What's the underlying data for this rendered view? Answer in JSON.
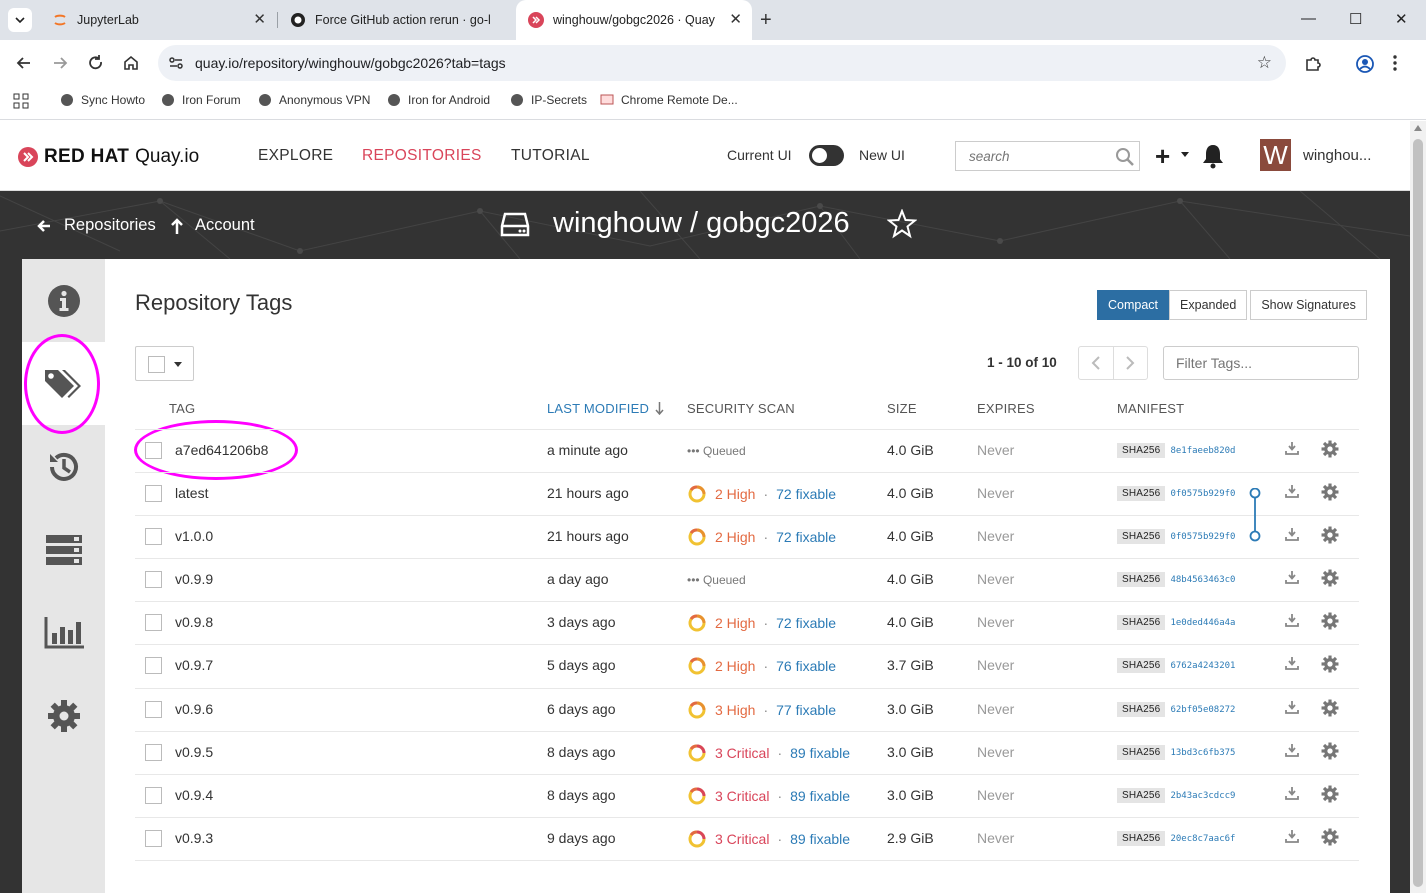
{
  "browser": {
    "tabs": [
      {
        "title": "JupyterLab"
      },
      {
        "title": "Force GitHub action rerun · go-l"
      },
      {
        "title": "winghouw/gobgc2026 · Quay"
      }
    ],
    "url": "quay.io/repository/winghouw/gobgc2026?tab=tags",
    "bookmarks": [
      "Sync Howto",
      "Iron Forum",
      "Anonymous VPN",
      "Iron for Android",
      "IP-Secrets",
      "Chrome Remote De..."
    ]
  },
  "header": {
    "logo_redhat": "RED HAT",
    "logo_quay": "Quay.io",
    "nav": [
      "EXPLORE",
      "REPOSITORIES",
      "TUTORIAL"
    ],
    "active_nav": "REPOSITORIES",
    "current_ui": "Current UI",
    "new_ui": "New UI",
    "search_placeholder": "search",
    "avatar_letter": "W",
    "username": "winghou..."
  },
  "repo": {
    "breadcrumb_repositories": "Repositories",
    "breadcrumb_account": "Account",
    "title": "winghouw / gobgc2026"
  },
  "tags_page": {
    "title": "Repository Tags",
    "view_buttons": [
      "Compact",
      "Expanded",
      "Show Signatures"
    ],
    "active_view": "Compact",
    "page_count": "1 - 10 of 10",
    "filter_placeholder": "Filter Tags...",
    "columns": [
      "TAG",
      "LAST MODIFIED",
      "SECURITY SCAN",
      "SIZE",
      "EXPIRES",
      "MANIFEST"
    ],
    "sort_column": "LAST MODIFIED",
    "rows": [
      {
        "tag": "a7ed641206b8",
        "modified": "a minute ago",
        "scan": "queued",
        "queued_text": "Queued",
        "size": "4.0 GiB",
        "expires": "Never",
        "sha": "SHA256",
        "digest": "8e1faeeb820d"
      },
      {
        "tag": "latest",
        "modified": "21 hours ago",
        "scan": "high",
        "severity": "2 High",
        "fixable": "72 fixable",
        "size": "4.0 GiB",
        "expires": "Never",
        "sha": "SHA256",
        "digest": "0f0575b929f0"
      },
      {
        "tag": "v1.0.0",
        "modified": "21 hours ago",
        "scan": "high",
        "severity": "2 High",
        "fixable": "72 fixable",
        "size": "4.0 GiB",
        "expires": "Never",
        "sha": "SHA256",
        "digest": "0f0575b929f0"
      },
      {
        "tag": "v0.9.9",
        "modified": "a day ago",
        "scan": "queued",
        "queued_text": "Queued",
        "size": "4.0 GiB",
        "expires": "Never",
        "sha": "SHA256",
        "digest": "48b4563463c0"
      },
      {
        "tag": "v0.9.8",
        "modified": "3 days ago",
        "scan": "high",
        "severity": "2 High",
        "fixable": "72 fixable",
        "size": "4.0 GiB",
        "expires": "Never",
        "sha": "SHA256",
        "digest": "1e0ded446a4a"
      },
      {
        "tag": "v0.9.7",
        "modified": "5 days ago",
        "scan": "high",
        "severity": "2 High",
        "fixable": "76 fixable",
        "size": "3.7 GiB",
        "expires": "Never",
        "sha": "SHA256",
        "digest": "6762a4243201"
      },
      {
        "tag": "v0.9.6",
        "modified": "6 days ago",
        "scan": "high",
        "severity": "3 High",
        "fixable": "77 fixable",
        "size": "3.0 GiB",
        "expires": "Never",
        "sha": "SHA256",
        "digest": "62bf05e08272"
      },
      {
        "tag": "v0.9.5",
        "modified": "8 days ago",
        "scan": "critical",
        "severity": "3 Critical",
        "fixable": "89 fixable",
        "size": "3.0 GiB",
        "expires": "Never",
        "sha": "SHA256",
        "digest": "13bd3c6fb375"
      },
      {
        "tag": "v0.9.4",
        "modified": "8 days ago",
        "scan": "critical",
        "severity": "3 Critical",
        "fixable": "89 fixable",
        "size": "3.0 GiB",
        "expires": "Never",
        "sha": "SHA256",
        "digest": "2b43ac3cdcc9"
      },
      {
        "tag": "v0.9.3",
        "modified": "9 days ago",
        "scan": "critical",
        "severity": "3 Critical",
        "fixable": "89 fixable",
        "size": "2.9 GiB",
        "expires": "Never",
        "sha": "SHA256",
        "digest": "20ec8c7aac6f"
      }
    ]
  },
  "colors": {
    "accent_blue": "#2c6ea3",
    "nav_active": "#d9455a",
    "severity_high": "#e36a42",
    "severity_critical": "#d9455a",
    "annotation": "#ff00ff"
  },
  "sidebar": {
    "icons": [
      "info-icon",
      "tags-icon",
      "history-icon",
      "builds-icon",
      "usage-logs-icon",
      "settings-icon"
    ],
    "selected": "tags-icon"
  }
}
